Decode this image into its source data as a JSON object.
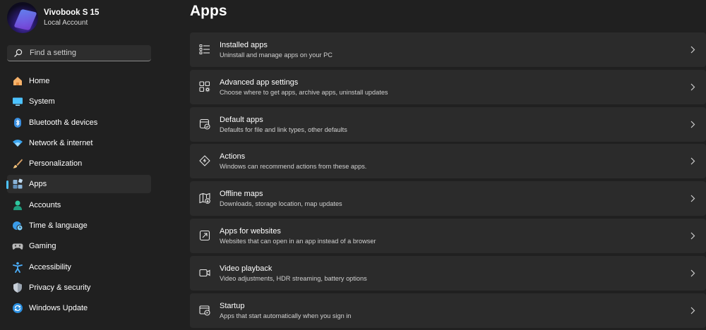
{
  "profile": {
    "name": "Vivobook S 15",
    "account": "Local Account"
  },
  "search": {
    "placeholder": "Find a setting"
  },
  "nav": {
    "items": [
      {
        "label": "Home",
        "icon": "home-icon"
      },
      {
        "label": "System",
        "icon": "system-icon"
      },
      {
        "label": "Bluetooth & devices",
        "icon": "bluetooth-icon"
      },
      {
        "label": "Network & internet",
        "icon": "wifi-icon"
      },
      {
        "label": "Personalization",
        "icon": "brush-icon"
      },
      {
        "label": "Apps",
        "icon": "apps-icon",
        "selected": true
      },
      {
        "label": "Accounts",
        "icon": "accounts-icon"
      },
      {
        "label": "Time & language",
        "icon": "globe-clock-icon"
      },
      {
        "label": "Gaming",
        "icon": "gamepad-icon"
      },
      {
        "label": "Accessibility",
        "icon": "accessibility-icon"
      },
      {
        "label": "Privacy & security",
        "icon": "shield-icon"
      },
      {
        "label": "Windows Update",
        "icon": "update-icon"
      }
    ]
  },
  "main": {
    "title": "Apps",
    "cards": [
      {
        "title": "Installed apps",
        "subtitle": "Uninstall and manage apps on your PC",
        "icon": "list-icon"
      },
      {
        "title": "Advanced app settings",
        "subtitle": "Choose where to get apps, archive apps, uninstall updates",
        "icon": "app-settings-icon"
      },
      {
        "title": "Default apps",
        "subtitle": "Defaults for file and link types, other defaults",
        "icon": "default-apps-icon"
      },
      {
        "title": "Actions",
        "subtitle": "Windows can recommend actions from these apps.",
        "icon": "actions-icon"
      },
      {
        "title": "Offline maps",
        "subtitle": "Downloads, storage location, map updates",
        "icon": "map-icon"
      },
      {
        "title": "Apps for websites",
        "subtitle": "Websites that can open in an app instead of a browser",
        "icon": "open-link-icon"
      },
      {
        "title": "Video playback",
        "subtitle": "Video adjustments, HDR streaming, battery options",
        "icon": "video-icon"
      },
      {
        "title": "Startup",
        "subtitle": "Apps that start automatically when you sign in",
        "icon": "startup-icon"
      }
    ]
  },
  "colors": {
    "background": "#202020",
    "card": "#2b2b2b",
    "accent": "#4cc2ff"
  }
}
